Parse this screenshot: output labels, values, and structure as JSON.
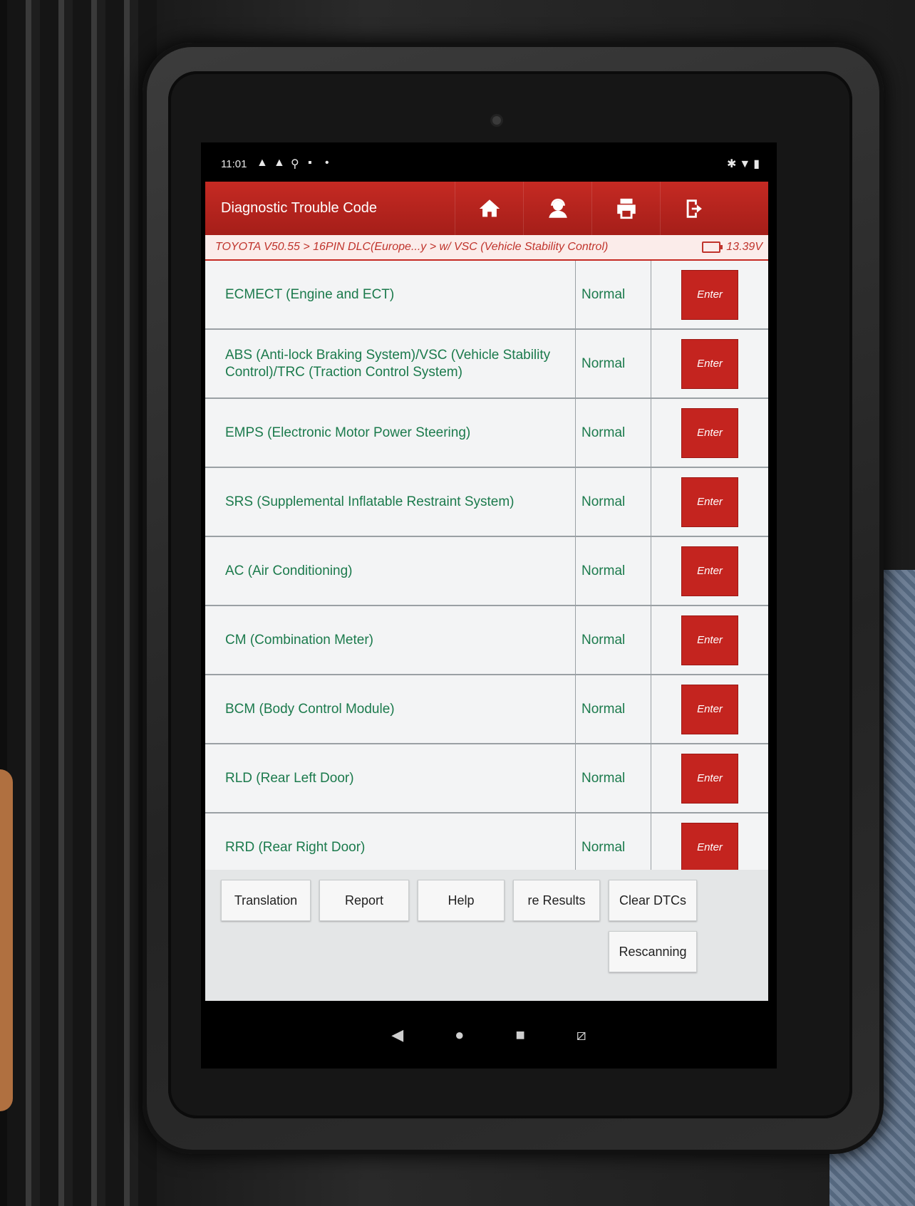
{
  "status_bar": {
    "time": "11:01",
    "notification_icons": [
      "warning-icon",
      "warning-icon",
      "usb-icon",
      "image-icon",
      "dot-icon"
    ],
    "right_icons": [
      "bluetooth-icon",
      "wifi-icon",
      "battery-icon"
    ]
  },
  "header": {
    "title": "Diagnostic Trouble Code",
    "buttons": [
      "home-icon",
      "support-icon",
      "print-icon",
      "exit-icon"
    ]
  },
  "breadcrumb": {
    "path": "TOYOTA V50.55 > 16PIN DLC(Europe...y > w/ VSC (Vehicle Stability Control)",
    "voltage": "13.39V"
  },
  "systems": [
    {
      "name": "ECMECT (Engine and ECT)",
      "status": "Normal",
      "action": "Enter"
    },
    {
      "name": "ABS (Anti-lock Braking System)/VSC (Vehicle Stability Control)/TRC (Traction Control System)",
      "status": "Normal",
      "action": "Enter"
    },
    {
      "name": "EMPS (Electronic Motor Power Steering)",
      "status": "Normal",
      "action": "Enter"
    },
    {
      "name": "SRS (Supplemental Inflatable Restraint System)",
      "status": "Normal",
      "action": "Enter"
    },
    {
      "name": "AC (Air Conditioning)",
      "status": "Normal",
      "action": "Enter"
    },
    {
      "name": "CM (Combination Meter)",
      "status": "Normal",
      "action": "Enter"
    },
    {
      "name": "BCM (Body Control Module)",
      "status": "Normal",
      "action": "Enter"
    },
    {
      "name": "RLD (Rear Left Door)",
      "status": "Normal",
      "action": "Enter"
    },
    {
      "name": "RRD (Rear Right Door)",
      "status": "Normal",
      "action": "Enter"
    }
  ],
  "footer": {
    "translation": "Translation",
    "report": "Report",
    "help": "Help",
    "results": "re Results",
    "clear_dtcs": "Clear DTCs",
    "rescanning": "Rescanning"
  },
  "nav": [
    "back-icon",
    "home-circle-icon",
    "recents-icon",
    "screenshot-icon"
  ],
  "colors": {
    "header": "#c52a23",
    "system_text": "#1b7a4c",
    "enter_button": "#c4241f"
  }
}
